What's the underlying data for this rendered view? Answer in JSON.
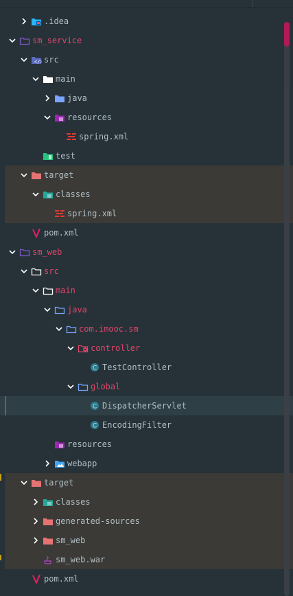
{
  "colors": {
    "background": "#263238",
    "text": "#b0bec5",
    "module_text": "#e0466c",
    "folder_plain": "#ffffff",
    "folder_src": "#5c6bc0",
    "folder_java": "#7aa5ff",
    "folder_resources": "#9c27b0",
    "folder_test": "#26c281",
    "folder_target": "#e57373",
    "folder_classes": "#26a69a",
    "class_icon": "#2b7d8f",
    "selection_bar": "#e91e63"
  },
  "tree": [
    {
      "label": "idea_label",
      "text": ".idea",
      "depth": 2,
      "arrow": "right",
      "icon": "folder-idea"
    },
    {
      "text": "sm_service",
      "depth": 1,
      "arrow": "down",
      "icon": "folder-module",
      "style": "module"
    },
    {
      "text": "src",
      "depth": 2,
      "arrow": "down",
      "icon": "folder-src"
    },
    {
      "text": "main",
      "depth": 3,
      "arrow": "down",
      "icon": "folder-plain"
    },
    {
      "text": "java",
      "depth": 4,
      "arrow": "right",
      "icon": "folder-java"
    },
    {
      "text": "resources",
      "depth": 4,
      "arrow": "down",
      "icon": "folder-resources"
    },
    {
      "text": "spring.xml",
      "depth": 5,
      "arrow": "none",
      "icon": "spring-xml"
    },
    {
      "text": "test",
      "depth": 3,
      "arrow": "none",
      "icon": "folder-test"
    },
    {
      "text": "target",
      "depth": 2,
      "arrow": "down",
      "icon": "folder-target",
      "shaded": true
    },
    {
      "text": "classes",
      "depth": 3,
      "arrow": "down",
      "icon": "folder-classes",
      "shaded": true
    },
    {
      "text": "spring.xml",
      "depth": 4,
      "arrow": "none",
      "icon": "spring-xml",
      "shaded": true
    },
    {
      "text": "pom.xml",
      "depth": 2,
      "arrow": "none",
      "icon": "maven"
    },
    {
      "text": "sm_web",
      "depth": 1,
      "arrow": "down",
      "icon": "folder-module",
      "style": "module"
    },
    {
      "text": "src",
      "depth": 2,
      "arrow": "down",
      "icon": "folder-outline",
      "style": "module"
    },
    {
      "text": "main",
      "depth": 3,
      "arrow": "down",
      "icon": "folder-outline",
      "style": "module"
    },
    {
      "text": "java",
      "depth": 4,
      "arrow": "down",
      "icon": "folder-outline-blue",
      "style": "module"
    },
    {
      "text": "com.imooc.sm",
      "depth": 5,
      "arrow": "down",
      "icon": "folder-outline-blue",
      "style": "module"
    },
    {
      "text": "controller",
      "depth": 6,
      "arrow": "down",
      "icon": "folder-controller",
      "style": "module"
    },
    {
      "text": "TestController",
      "depth": 7,
      "arrow": "none",
      "icon": "class"
    },
    {
      "text": "global",
      "depth": 6,
      "arrow": "down",
      "icon": "folder-outline-blue",
      "style": "module"
    },
    {
      "text": "DispatcherServlet",
      "depth": 7,
      "arrow": "none",
      "icon": "class",
      "selected": true
    },
    {
      "text": "EncodingFilter",
      "depth": 7,
      "arrow": "none",
      "icon": "class"
    },
    {
      "text": "resources",
      "depth": 4,
      "arrow": "none",
      "icon": "folder-resources"
    },
    {
      "text": "webapp",
      "depth": 4,
      "arrow": "right",
      "icon": "folder-webapp"
    },
    {
      "text": "target",
      "depth": 2,
      "arrow": "down",
      "icon": "folder-target",
      "shaded": true
    },
    {
      "text": "classes",
      "depth": 3,
      "arrow": "right",
      "icon": "folder-classes",
      "shaded": true
    },
    {
      "text": "generated-sources",
      "depth": 3,
      "arrow": "right",
      "icon": "folder-target",
      "shaded": true
    },
    {
      "text": "sm_web",
      "depth": 3,
      "arrow": "right",
      "icon": "folder-target",
      "shaded": true
    },
    {
      "text": "sm_web.war",
      "depth": 3,
      "arrow": "none",
      "icon": "war",
      "shaded": true
    },
    {
      "text": "pom.xml",
      "depth": 2,
      "arrow": "none",
      "icon": "maven"
    }
  ]
}
